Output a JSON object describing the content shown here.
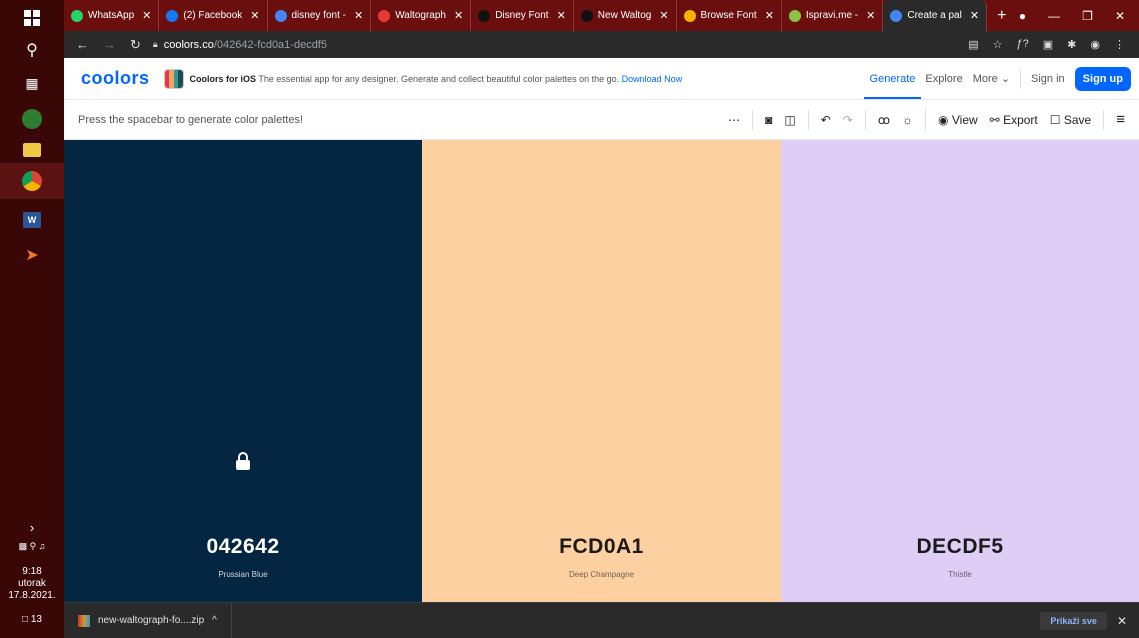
{
  "taskbar": {
    "tray_time": "9:18",
    "tray_day": "utorak",
    "tray_date": "17.8.2021.",
    "notif_count": "13"
  },
  "browser": {
    "tabs": [
      {
        "label": "WhatsApp",
        "color": "#25d366"
      },
      {
        "label": "(2) Facebook",
        "color": "#1877f2"
      },
      {
        "label": "disney font -",
        "color": "#4285f4"
      },
      {
        "label": "Waltograph",
        "color": "#e53935"
      },
      {
        "label": "Disney Font",
        "color": "#111111"
      },
      {
        "label": "New Waltog",
        "color": "#111111"
      },
      {
        "label": "Browse Font",
        "color": "#f4b400"
      },
      {
        "label": "Ispravi.me -",
        "color": "#8bc34a"
      },
      {
        "label": "Create a pal",
        "color": "#4285f4"
      }
    ],
    "url_host": "coolors.co",
    "url_path": "/042642-fcd0a1-decdf5"
  },
  "header": {
    "logo": "coolors",
    "ios_title": "Coolors for iOS",
    "ios_desc": "The essential app for any designer. Generate and collect beautiful color palettes on the go.",
    "ios_link": "Download Now",
    "nav_generate": "Generate",
    "nav_explore": "Explore",
    "nav_more": "More",
    "sign_in": "Sign in",
    "sign_up": "Sign up"
  },
  "toolbar": {
    "hint": "Press the spacebar to generate color palettes!",
    "view_label": "View",
    "export_label": "Export",
    "save_label": "Save"
  },
  "palette": [
    {
      "hex": "042642",
      "name": "Prussian Blue",
      "color": "#042642",
      "text_color": "#ffffff",
      "locked": true
    },
    {
      "hex": "FCD0A1",
      "name": "Deep Champagne",
      "color": "#fcd0a1",
      "text_color": "#1a1a1a",
      "locked": false
    },
    {
      "hex": "DECDF5",
      "name": "Thistle",
      "color": "#decdf5",
      "text_color": "#1a1a1a",
      "locked": false
    }
  ],
  "downloads": {
    "file": "new-waltograph-fo....zip",
    "show_all": "Prikaži sve"
  }
}
